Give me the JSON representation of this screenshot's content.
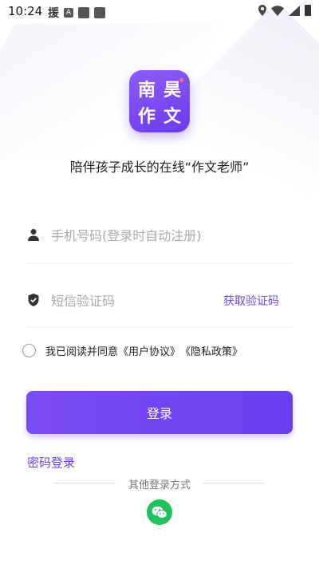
{
  "status": {
    "time": "10:24",
    "left_text": "援",
    "a_icon": "A"
  },
  "logo": {
    "chars": [
      "南",
      "昊",
      "作",
      "文"
    ]
  },
  "slogan": "陪伴孩子成长的在线“作文老师”",
  "phone": {
    "placeholder": "手机号码(登录时自动注册)",
    "value": ""
  },
  "code": {
    "placeholder": "短信验证码",
    "value": "",
    "get_code_label": "获取验证码"
  },
  "agreement": {
    "prefix": "我已阅读并同意",
    "user_agreement": "《用户协议》",
    "privacy_policy": "《隐私政策》"
  },
  "login_button": "登录",
  "password_login": "密码登录",
  "other_login": "其他登录方式",
  "colors": {
    "accent": "#6a3ff0",
    "wechat": "#1fc35b"
  },
  "icons": [
    "user-icon",
    "shield-icon",
    "wechat-icon",
    "location-icon",
    "wifi-icon",
    "signal-icon",
    "battery-icon"
  ]
}
